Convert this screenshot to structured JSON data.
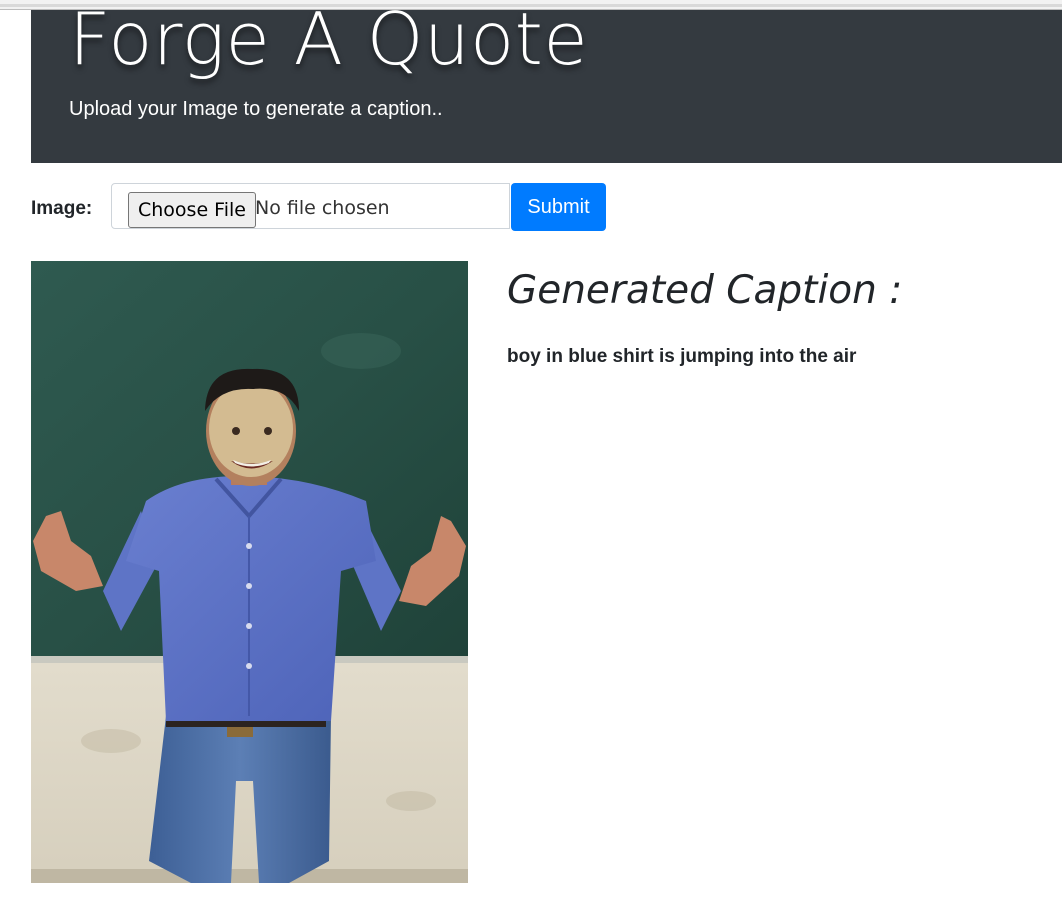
{
  "header": {
    "title": "Forge A Quote",
    "subtitle": "Upload your Image to generate a caption.."
  },
  "form": {
    "label": "Image:",
    "choose_file_label": "Choose File",
    "no_file_text": "No file chosen",
    "submit_label": "Submit"
  },
  "result": {
    "heading": "Generated Caption :",
    "caption": "boy in blue shirt is jumping into the air"
  },
  "colors": {
    "header_bg": "#343a40",
    "primary": "#007bff"
  }
}
